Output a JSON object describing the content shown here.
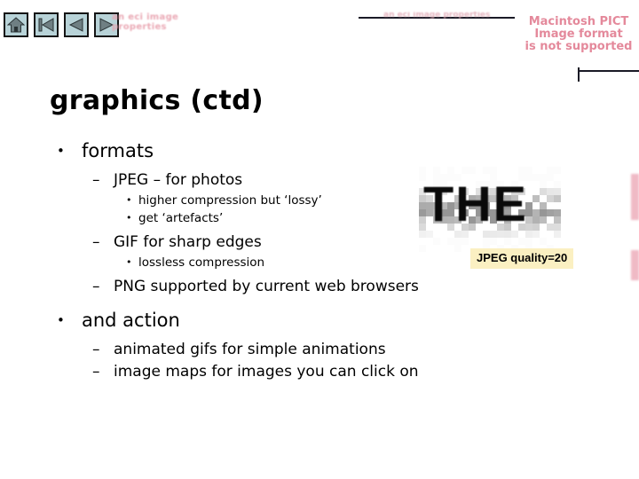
{
  "nav": {
    "buttons": [
      {
        "name": "home",
        "label": "Home",
        "icon": "home-icon"
      },
      {
        "name": "first",
        "label": "First slide",
        "icon": "first-slide-icon"
      },
      {
        "name": "previous",
        "label": "Previous slide",
        "icon": "previous-slide-icon"
      },
      {
        "name": "next",
        "label": "Next slide",
        "icon": "next-slide-icon"
      }
    ]
  },
  "header": {
    "pink_left_text": "an eci image properties",
    "pink_rule_text": "an eci image properties"
  },
  "pict_placeholder": {
    "line1": "Macintosh PICT",
    "line2": "Image format",
    "line3": "is not supported"
  },
  "slide": {
    "title": "graphics (ctd)",
    "bullets": {
      "formats": "formats",
      "jpeg": "JPEG – for photos",
      "jpeg_sub1": "higher compression but ‘lossy’",
      "jpeg_sub2": "get ‘artefacts’",
      "gif": "GIF for sharp edges",
      "gif_sub1": "lossless compression",
      "png": "PNG supported by current web browsers",
      "action": "and action",
      "action_sub1": "animated gifs for simple animations",
      "action_sub2": "image maps for images you can click on"
    },
    "markers": {
      "disc": "•",
      "dash": "–"
    }
  },
  "jpeg_demo": {
    "image_text": "THE",
    "caption": "JPEG quality=20"
  },
  "colors": {
    "pink_text": "#e4899b",
    "nav_button_face": "#b8d3d8",
    "nav_button_border": "#151515",
    "label_background": "#fbf0c2",
    "body_text": "#000000"
  }
}
